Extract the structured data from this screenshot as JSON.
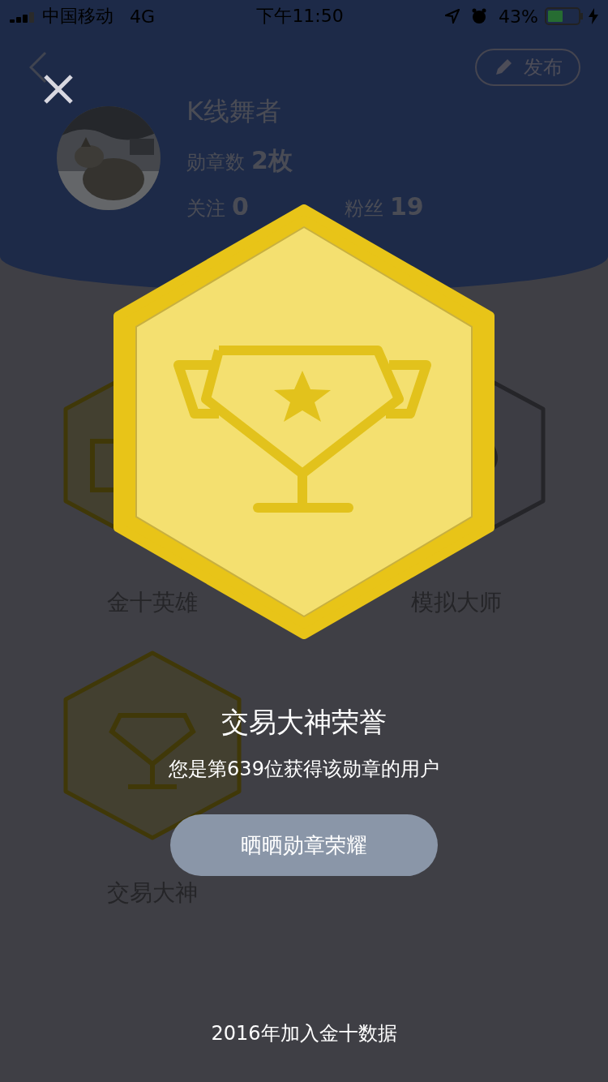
{
  "status_bar": {
    "carrier": "中国移动",
    "network": "4G",
    "time": "下午11:50",
    "battery": "43%"
  },
  "profile": {
    "publish_button": "发布",
    "name": "K线舞者",
    "badge_count_label": "勋章数",
    "badge_count": "2枚",
    "following_label": "关注",
    "following": "0",
    "fans_label": "粉丝",
    "fans": "19"
  },
  "badges": [
    {
      "name": "金十英雄",
      "kind": "hero",
      "earned": true
    },
    {
      "name": "模拟大师",
      "kind": "simulator",
      "earned": false
    },
    {
      "name": "交易大神",
      "kind": "trophy",
      "earned": true
    }
  ],
  "modal": {
    "title": "交易大神荣誉",
    "subtitle": "您是第639位获得该勋章的用户",
    "share_button": "晒晒勋章荣耀",
    "footer": "2016年加入金十数据"
  }
}
